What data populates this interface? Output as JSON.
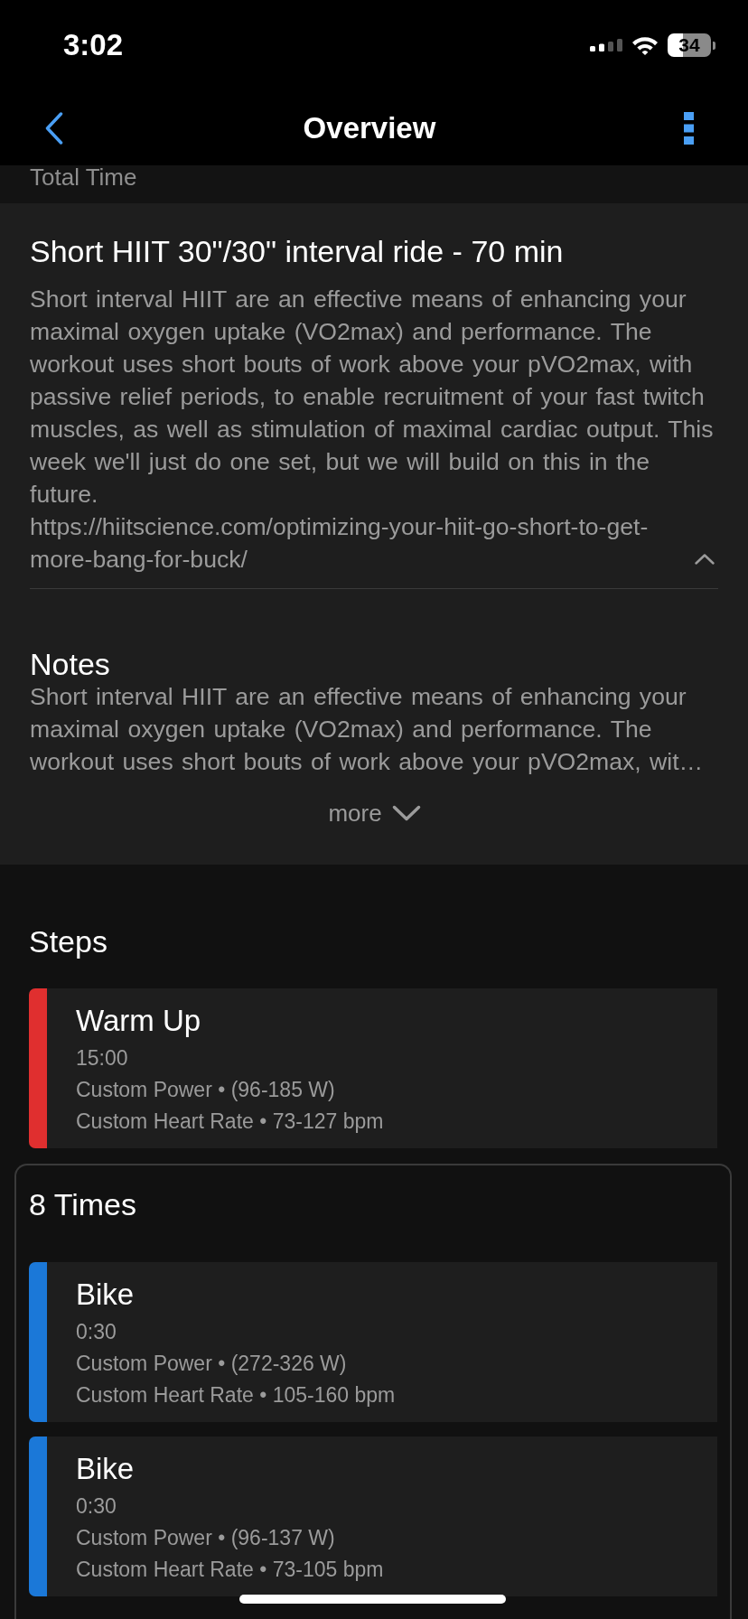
{
  "status_bar": {
    "time": "3:02",
    "battery": "34"
  },
  "nav": {
    "title": "Overview"
  },
  "summary_row": {
    "label": "Total Time"
  },
  "workout": {
    "title": "Short HIIT 30\"/30\" interval ride - 70 min",
    "description": "Short interval HIIT are an effective means of enhancing your maximal oxygen uptake (VO2max) and performance. The workout uses short bouts of work above your pVO2max, with passive relief periods, to enable recruitment of your fast twitch muscles, as well as stimulation of maximal cardiac output. This week we'll just do one set, but we will build on this in the future.",
    "url": "https://hiitscience.com/optimizing-your-hiit-go-short-to-get-more-bang-for-buck/",
    "expanded": true
  },
  "notes": {
    "title": "Notes",
    "text": "Short interval HIIT are an effective means of enhancing your maximal oxygen uptake (VO2max) and performance. The workout uses short bouts of work above your pVO2max, wit…",
    "more": "more",
    "expanded": false
  },
  "steps": {
    "title": "Steps",
    "items": [
      {
        "kind": "step",
        "name": "Warm Up",
        "duration": "15:00",
        "targets": [
          "Custom Power • (96-185 W)",
          "Custom Heart Rate • 73-127 bpm"
        ],
        "color": "#e02f2f"
      },
      {
        "kind": "repeat",
        "label": "8 Times",
        "children": [
          {
            "kind": "step",
            "name": "Bike",
            "duration": "0:30",
            "targets": [
              "Custom Power • (272-326 W)",
              "Custom Heart Rate • 105-160 bpm"
            ],
            "color": "#1b78d8"
          },
          {
            "kind": "step",
            "name": "Bike",
            "duration": "0:30",
            "targets": [
              "Custom Power • (96-137 W)",
              "Custom Heart Rate • 73-105 bpm"
            ],
            "color": "#1b78d8"
          }
        ]
      }
    ]
  }
}
